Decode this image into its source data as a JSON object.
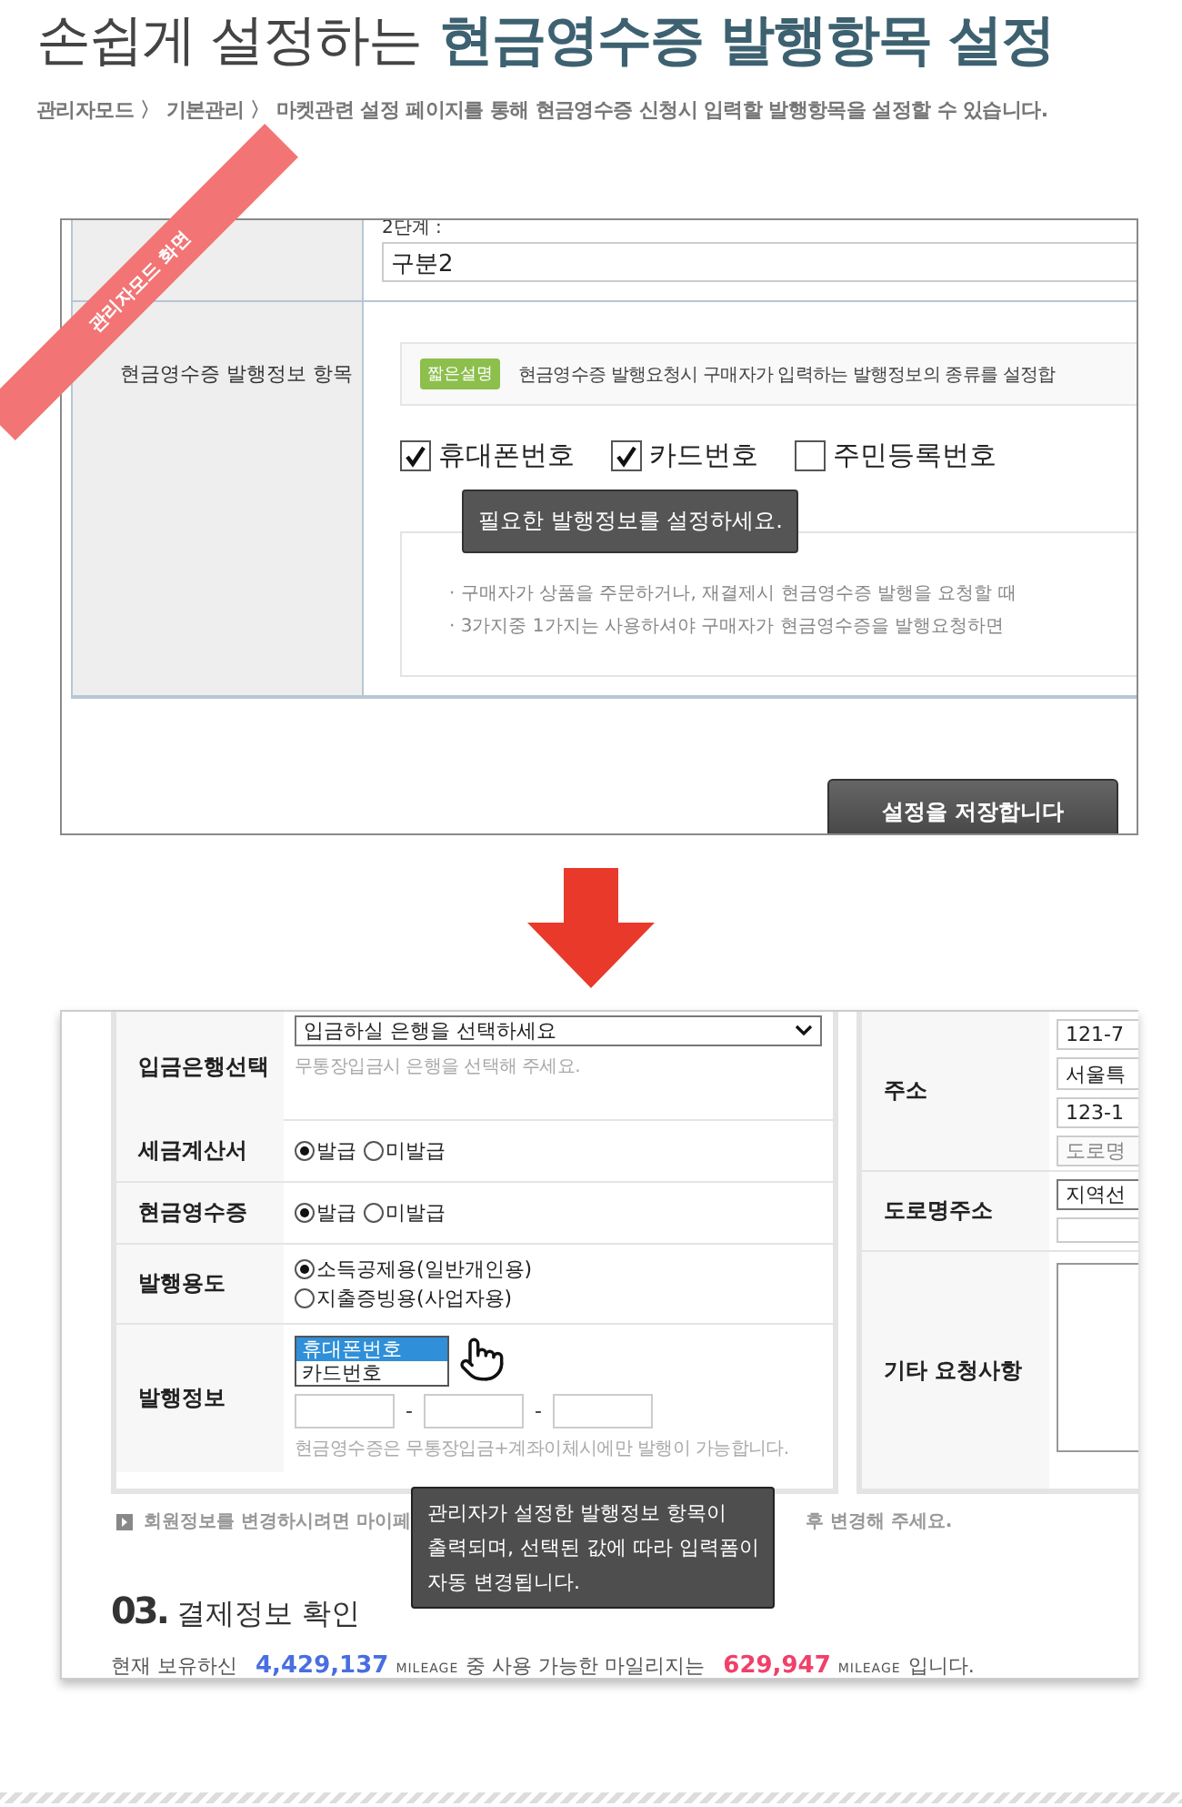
{
  "header": {
    "title_lead": "손쉽게 설정하는",
    "title_highlight": "현금영수증 발행항목 설정",
    "breadcrumb": "관리자모드 〉 기본관리 〉 마켓관련 설정 페이지를 통해 현금영수증 신청시 입력할 발행항목을 설정할 수 있습니다."
  },
  "admin_screen": {
    "ribbon": "관리자모드 화면",
    "step_label": "2단계 :",
    "step_value": "구분2",
    "row_label": "현금영수증 발행정보 항목",
    "badge": "짧은설명",
    "description": "현금영수증 발행요청시 구매자가 입력하는 발행정보의 종류를 설정합",
    "options": [
      {
        "label": "휴대폰번호",
        "checked": true
      },
      {
        "label": "카드번호",
        "checked": true
      },
      {
        "label": "주민등록번호",
        "checked": false
      }
    ],
    "tooltip": "필요한 발행정보를 설정하세요.",
    "help_lines": [
      "· 구매자가 상품을 주문하거나, 재결제시 현금영수증 발행을 요청할 때",
      "· 3가지중 1가지는 사용하셔야 구매자가 현금영수증을 발행요청하면"
    ],
    "save_button": "설정을 저장합니다"
  },
  "order_screen": {
    "form_rows": [
      {
        "kind": "select",
        "label": "입금은행선택",
        "value": "입금하실 은행을 선택하세요",
        "hint": "무통장입금시 은행을 선택해 주세요."
      },
      {
        "kind": "radio",
        "label": "세금계산서",
        "options": [
          {
            "label": "발급",
            "selected": true
          },
          {
            "label": "미발급",
            "selected": false
          }
        ]
      },
      {
        "kind": "radio",
        "label": "현금영수증",
        "options": [
          {
            "label": "발급",
            "selected": true
          },
          {
            "label": "미발급",
            "selected": false
          }
        ]
      },
      {
        "kind": "radio_stack",
        "label": "발행용도",
        "options": [
          {
            "label": "소득공제용(일반개인용)",
            "selected": true
          },
          {
            "label": "지출증빙용(사업자용)",
            "selected": false
          }
        ]
      },
      {
        "kind": "issue_info",
        "label": "발행정보",
        "list": [
          {
            "label": "휴대폰번호",
            "selected": true
          },
          {
            "label": "카드번호",
            "selected": false
          }
        ],
        "separator": "-",
        "hint": "현금영수증은 무통장입금+계좌이체시에만 발행이 가능합니다."
      }
    ],
    "address_rows": [
      {
        "kind": "address",
        "label": "주소",
        "fields": [
          "121-7",
          "서울특",
          "123-1"
        ],
        "button": "도로명"
      },
      {
        "kind": "road",
        "label": "도로명주소",
        "select": "지역선"
      },
      {
        "kind": "textarea",
        "label": "기타 요청사항"
      }
    ],
    "notice_start": "회원정보를 변경하시려면 **마이페**",
    "notice_end": "후 변경해 주세요.",
    "tooltip_lines": [
      "관리자가 설정한 발행정보 항목이",
      "출력되며, 선택된 값에 따라 입력폼이",
      "자동 변경됩니다."
    ],
    "section_number": "03.",
    "section_title": "결제정보 확인",
    "mileage": {
      "prefix": "현재 보유하신",
      "owned": "4,429,137",
      "unit": "MILEAGE",
      "middle": "중 사용 가능한 마일리지는",
      "usable": "629,947",
      "unit_2": "MILEAGE",
      "suffix": "입니다."
    }
  }
}
